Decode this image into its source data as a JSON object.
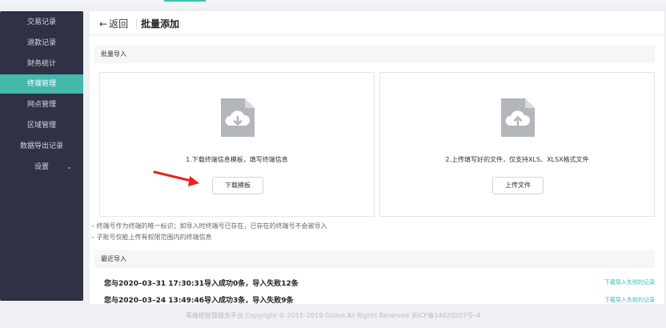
{
  "sidebar": {
    "items": [
      {
        "label": "交易记录"
      },
      {
        "label": "退款记录"
      },
      {
        "label": "财务统计"
      },
      {
        "label": "终端管理"
      },
      {
        "label": "网点管理"
      },
      {
        "label": "区域管理"
      },
      {
        "label": "数据导出记录"
      },
      {
        "label": "设置"
      }
    ],
    "active_index": 3
  },
  "header": {
    "back_label": "返回",
    "title": "批量添加"
  },
  "import": {
    "section_title": "批量导入",
    "download": {
      "text": "1.下载终端信息模板，填写终端信息",
      "button": "下载模板"
    },
    "upload": {
      "text": "2.上传填写好的文件，仅支持XLS、XLSX格式文件",
      "button": "上传文件"
    }
  },
  "notes": [
    "– 终端号作为终端的唯一标识；如导入时终端号已存在，已存在的终端号不会被导入",
    "– 子账号仅能上传有权限范围内的终端信息"
  ],
  "recent": {
    "section_title": "最近导入",
    "records": [
      {
        "text": "您与2020–03–31 17:30:31导入成功0条，导入失败12条",
        "link": "下载导入失败的记录"
      },
      {
        "text": "您与2020–03–24 13:49:46导入成功3条，导入失败9条",
        "link": "下载导入失败的记录"
      }
    ]
  },
  "footer": "青橄榄智慧服务平台 Copyright © 2015–2019 Golive All Rights Reserved  浙ICP备14020207号–4",
  "colors": {
    "sidebar": "#2e3244",
    "accent": "#45b8ac",
    "link": "#3cb7ad"
  }
}
